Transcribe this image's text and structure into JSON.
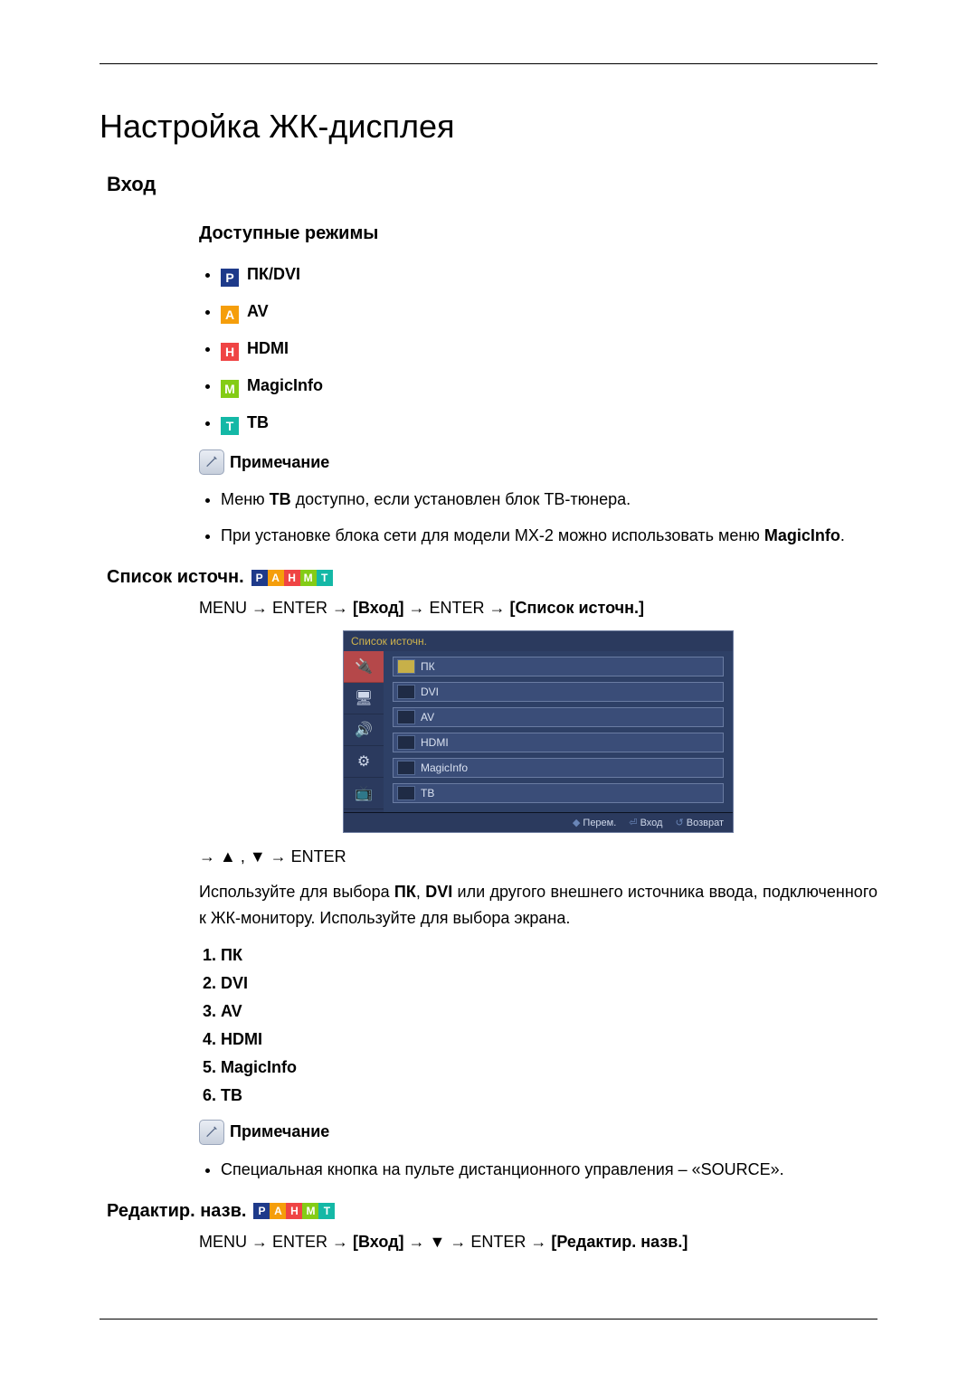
{
  "pageTitle": "Настройка ЖК-дисплея",
  "section1": {
    "title": "Вход",
    "modesHeading": "Доступные режимы",
    "modes": [
      {
        "icon": "P",
        "cls": "bg-p",
        "label": "ПК/DVI"
      },
      {
        "icon": "A",
        "cls": "bg-a",
        "label": "AV"
      },
      {
        "icon": "H",
        "cls": "bg-h",
        "label": "HDMI"
      },
      {
        "icon": "M",
        "cls": "bg-m",
        "label": "MagicInfo"
      },
      {
        "icon": "T",
        "cls": "bg-t",
        "label": "ТВ"
      }
    ],
    "noteTitle": "Примечание",
    "notes": {
      "0_pre": "Меню ",
      "0_bold": "ТВ",
      "0_post": " доступно, если установлен блок ТВ-тюнера.",
      "1_pre": "При установке блока сети для модели MX-2 можно использовать меню ",
      "1_bold": "MagicInfo",
      "1_post": "."
    }
  },
  "sourceList": {
    "title": "Список источн.",
    "menuPath": {
      "p1": "MENU → ENTER → ",
      "b1": "[Вход]",
      "p2": " → ENTER → ",
      "b2": "[Список источн.]"
    },
    "osd": {
      "title": "Список источн.",
      "items": [
        "ПК",
        "DVI",
        "AV",
        "HDMI",
        "MagicInfo",
        "ТВ"
      ],
      "footer": {
        "move": "Перем.",
        "enter": "Вход",
        "return": "Возврат"
      }
    },
    "arrowLine": "→ ▲ , ▼ → ENTER",
    "body": {
      "pre": "Используйте для выбора ",
      "b1": "ПК",
      "mid1": ", ",
      "b2": "DVI",
      "post": " или другого внешнего источника ввода, подключенного к ЖК-монитору. Используйте для выбора экрана."
    },
    "numbered": [
      "ПК",
      "DVI",
      "AV",
      "HDMI",
      "MagicInfo",
      "ТВ"
    ],
    "note2Title": "Примечание",
    "note2Item": "Специальная кнопка на пульте дистанционного управления – «SOURCE»."
  },
  "editName": {
    "title": "Редактир. назв.",
    "menuPath": {
      "p1": "MENU → ENTER → ",
      "b1": "[Вход]",
      "p2": " → ▼ → ENTER → ",
      "b2": "[Редактир. назв.]"
    }
  },
  "pahmt": [
    {
      "icon": "P",
      "cls": "bg-p"
    },
    {
      "icon": "A",
      "cls": "bg-a"
    },
    {
      "icon": "H",
      "cls": "bg-h"
    },
    {
      "icon": "M",
      "cls": "bg-m"
    },
    {
      "icon": "T",
      "cls": "bg-t"
    }
  ]
}
